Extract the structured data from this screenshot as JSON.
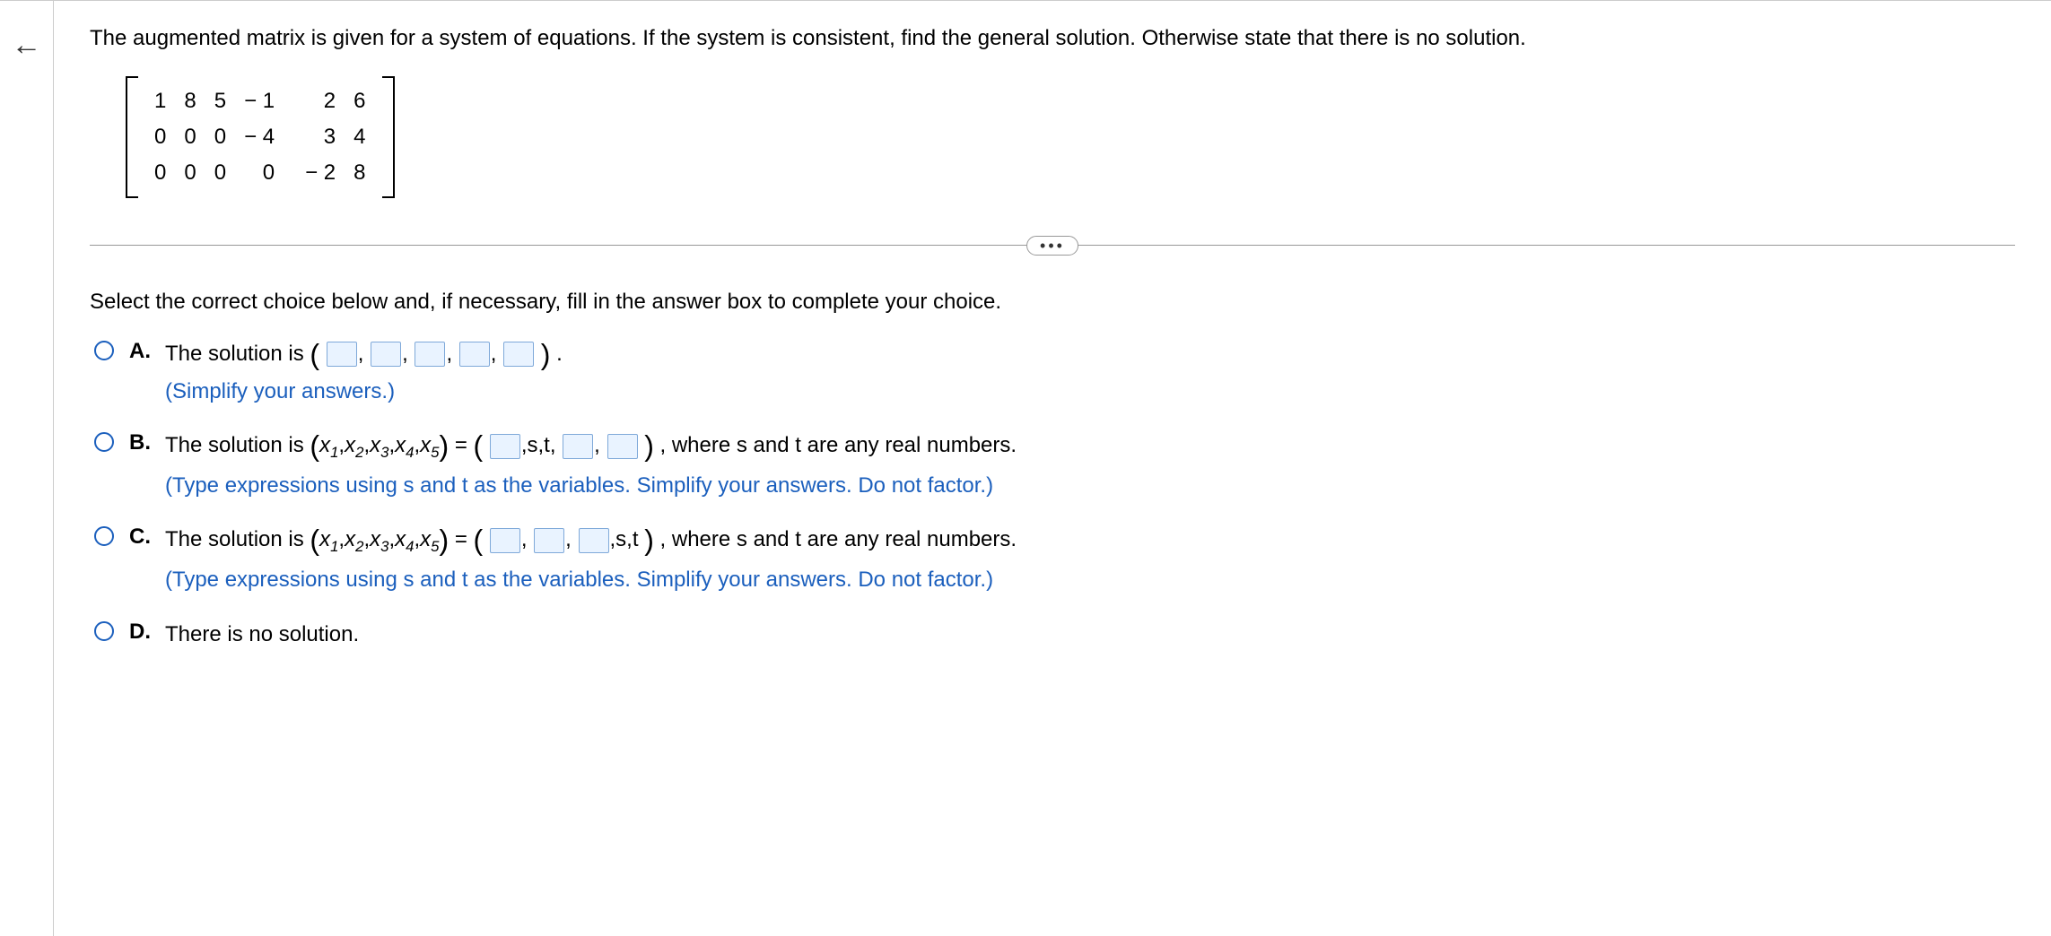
{
  "question": {
    "prompt": "The augmented matrix is given for a system of equations. If the system is consistent, find the general solution. Otherwise state that there is no solution.",
    "matrix": {
      "rows": [
        [
          "1",
          "8",
          "5",
          "− 1",
          "2",
          "6"
        ],
        [
          "0",
          "0",
          "0",
          "− 4",
          "3",
          "4"
        ],
        [
          "0",
          "0",
          "0",
          "0",
          "− 2",
          "8"
        ]
      ]
    },
    "ellipsis": "•••",
    "instruction": "Select the correct choice below and, if necessary, fill in the answer box to complete your choice."
  },
  "choices": {
    "a": {
      "letter": "A.",
      "lead": "The solution is ",
      "tail": ".",
      "hint": "(Simplify your answers.)"
    },
    "b": {
      "letter": "B.",
      "lead": "The solution is ",
      "vars_open": "(",
      "vars": "x",
      "mid1": ",s,t,",
      "mid2": ",",
      "close": ")",
      "tail": ", where s and t are any real numbers.",
      "hint": "(Type expressions using s and t as the variables. Simplify your answers. Do not factor.)"
    },
    "c": {
      "letter": "C.",
      "lead": "The solution is ",
      "mid1": ",",
      "mid2": ",",
      "mid3": ",s,t",
      "close": ")",
      "tail": ", where s and t are any real numbers.",
      "hint": "(Type expressions using s and t as the variables. Simplify your answers. Do not factor.)"
    },
    "d": {
      "letter": "D.",
      "text": "There is no solution."
    }
  },
  "math": {
    "equals": " = ",
    "tuple_label": "x₁,x₂,x₃,x₄,x₅",
    "comma": ","
  }
}
